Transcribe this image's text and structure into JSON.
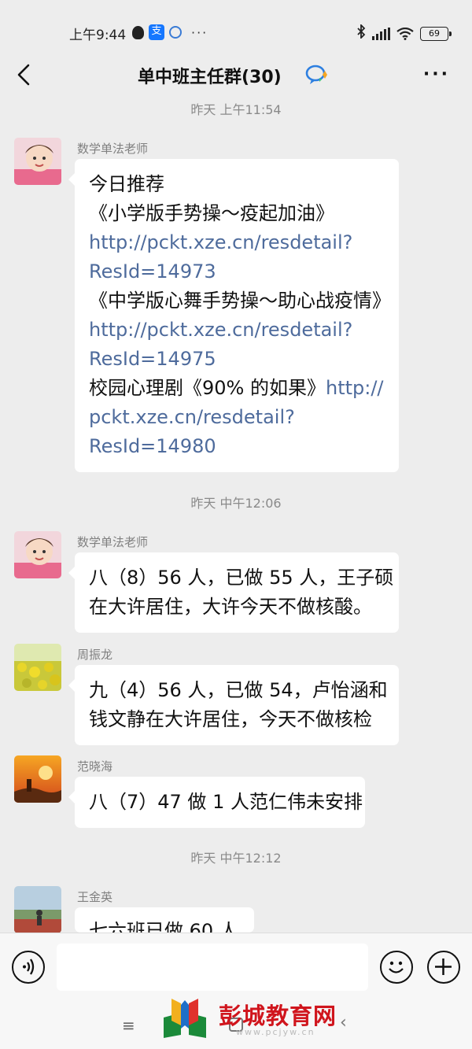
{
  "status_bar": {
    "time": "上午9:44",
    "alipay_glyph": "支",
    "battery": "69"
  },
  "header": {
    "title": "单中班主任群(30)",
    "back_icon": "chevron-left-icon",
    "more_icon": "more-dots-icon",
    "more_label": "···"
  },
  "messages": [
    {
      "timestamp": "昨天 上午11:54",
      "sender": "数学单法老师",
      "lines": [
        {
          "text": "今日推荐",
          "link": false
        },
        {
          "text": "《小学版手势操～疫起加油》",
          "link": false
        },
        {
          "text": "http://pckt.xze.cn/resdetail?",
          "link": true
        },
        {
          "text": "ResId=14973",
          "link": true
        },
        {
          "text": "《中学版心舞手势操～助心战疫情》",
          "link": false
        },
        {
          "text": "http://pckt.xze.cn/resdetail?",
          "link": true
        },
        {
          "text": "ResId=14975",
          "link": true
        },
        {
          "text": "校园心理剧《90% 的如果》",
          "link": false,
          "suffix_link": "http://"
        },
        {
          "text": "pckt.xze.cn/resdetail?",
          "link": true
        },
        {
          "text": "ResId=14980",
          "link": true
        }
      ]
    }
  ],
  "timestamps": {
    "t1": "昨天 上午11:54",
    "t2": "昨天 中午12:06",
    "t3": "昨天 中午12:12"
  },
  "msg1": {
    "sender": "数学单法老师",
    "l1": "今日推荐",
    "l2": "《小学版手势操～疫起加油》",
    "l3": "http://pckt.xze.cn/resdetail?",
    "l4": "ResId=14973",
    "l5": "《中学版心舞手势操～助心战疫情》",
    "l6": "http://pckt.xze.cn/resdetail?",
    "l7": "ResId=14975",
    "l8a": "校园心理剧《90% 的如果》",
    "l8b": "http://",
    "l9": "pckt.xze.cn/resdetail?",
    "l10": "ResId=14980"
  },
  "msg2": {
    "sender": "数学单法老师",
    "l1": "八（8）56 人，已做 55 人，王子硕",
    "l2": "在大许居住，大许今天不做核酸。"
  },
  "msg3": {
    "sender": "周振龙",
    "l1": "九（4）56 人，已做 54，卢怡涵和",
    "l2": "钱文静在大许居住，今天不做核检"
  },
  "msg4": {
    "sender": "范晓海",
    "l1": "八（7）47 做 1 人范仁伟未安排"
  },
  "msg5": {
    "sender": "王金英",
    "l1": "七六班已做 60 人"
  },
  "input": {
    "value": "",
    "voice_icon": "voice-icon",
    "emoji_icon": "emoji-icon",
    "plus_icon": "plus-icon"
  },
  "nav": {
    "menu_glyph": "≡",
    "back_glyph": "‹"
  },
  "watermark": {
    "text": "彭城教育网",
    "url": "www.pcjyw.cn"
  },
  "colors": {
    "background": "#ededed",
    "bubble": "#ffffff",
    "link": "#4e6b9c",
    "timestamp": "#8a8a8a",
    "watermark": "#d0151d"
  }
}
